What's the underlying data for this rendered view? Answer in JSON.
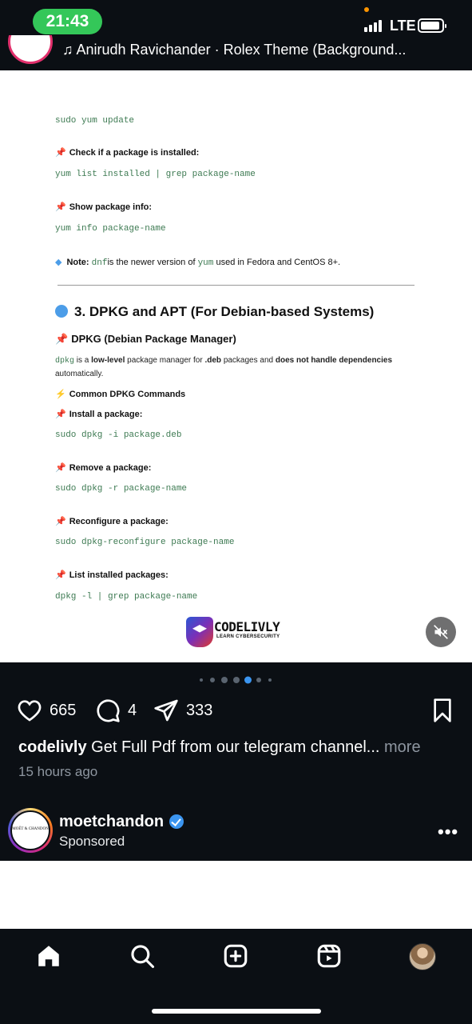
{
  "status_bar": {
    "time": "21:43",
    "network": "LTE"
  },
  "header": {
    "title": "Anirudh Ravichander · Rolex Theme (Background..."
  },
  "document": {
    "cmd_update": "sudo yum update",
    "check_label": "Check if a package is installed:",
    "cmd_check": "yum list installed | grep package-name",
    "info_label": "Show package info:",
    "cmd_info": "yum info package-name",
    "note_prefix": "Note:",
    "note_code1": "dnf",
    "note_mid": "is the newer version of",
    "note_code2": "yum",
    "note_suffix": "used in Fedora and CentOS 8+.",
    "section_title": "3. DPKG and APT (For Debian-based Systems)",
    "sub_title": "DPKG (Debian Package Manager)",
    "para_code": "dpkg",
    "para_a": "is a",
    "para_bold1": "low-level",
    "para_b": "package manager for",
    "para_bold2": ".deb",
    "para_c": "packages and",
    "para_bold3": "does not handle dependencies",
    "para_d": "automatically.",
    "common_label": "Common DPKG Commands",
    "install_label": "Install a package:",
    "cmd_install": "sudo dpkg -i package.deb",
    "remove_label": "Remove a package:",
    "cmd_remove": "sudo dpkg -r package-name",
    "reconfig_label": "Reconfigure a package:",
    "cmd_reconfig": "sudo dpkg-reconfigure package-name",
    "list_label": "List installed packages:",
    "cmd_list": "dpkg -l | grep package-name",
    "logo_title": "CODELIVLY",
    "logo_subtitle": "LEARN CYBERSECURITY"
  },
  "post": {
    "likes": "665",
    "comments": "4",
    "shares": "333",
    "username": "codelivly",
    "caption": "Get Full Pdf from our telegram channel...",
    "more": "more",
    "time_ago": "15 hours ago",
    "carousel_active_index": 4,
    "carousel_count": 6
  },
  "sponsored": {
    "name": "moetchandon",
    "label": "Sponsored",
    "avatar_text": "MOËT & CHANDON"
  },
  "icons": {
    "like": "heart-icon",
    "comment": "comment-icon",
    "share": "send-icon",
    "save": "bookmark-icon",
    "mute": "muted-speaker-icon",
    "home": "home-icon",
    "search": "search-icon",
    "create": "plus-square-icon",
    "reels": "reels-icon"
  },
  "colors": {
    "time_pill": "#34c759",
    "code_text": "#3d7a52",
    "verified": "#3b95f0",
    "background": "#0b0f14"
  }
}
